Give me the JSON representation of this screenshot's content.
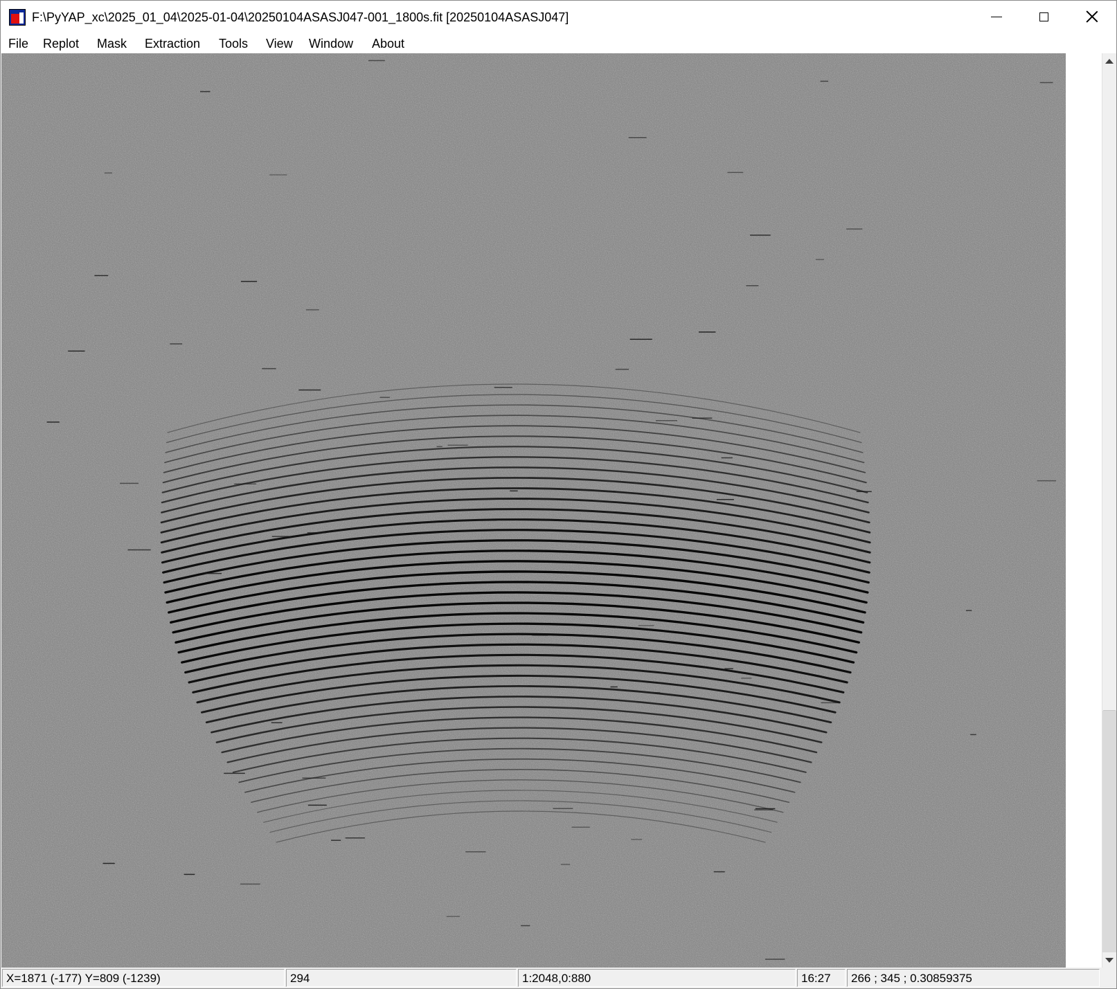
{
  "window": {
    "title": "F:\\PyYAP_xc\\2025_01_04\\2025-01-04\\20250104ASASJ047-001_1800s.fit [20250104ASASJ047]"
  },
  "menu": {
    "items": [
      "File",
      "Replot",
      "Mask",
      "Extraction",
      "Tools",
      "View",
      "Window",
      "About"
    ]
  },
  "image": {
    "background_color": "#808080",
    "order_color": "#000000",
    "order_count": 42
  },
  "status": {
    "coordinates": "X=1871 (-177) Y=809 (-1239)",
    "value": "294",
    "zoom": "1:2048,0:880",
    "time": "16:27",
    "stats": "266 ; 345 ; 0.30859375"
  },
  "icons": {
    "app": "app-logo-icon",
    "minimize": "minimize-icon",
    "maximize": "maximize-icon",
    "close": "close-icon",
    "scroll_up": "arrow-up-icon",
    "scroll_down": "arrow-down-icon"
  }
}
